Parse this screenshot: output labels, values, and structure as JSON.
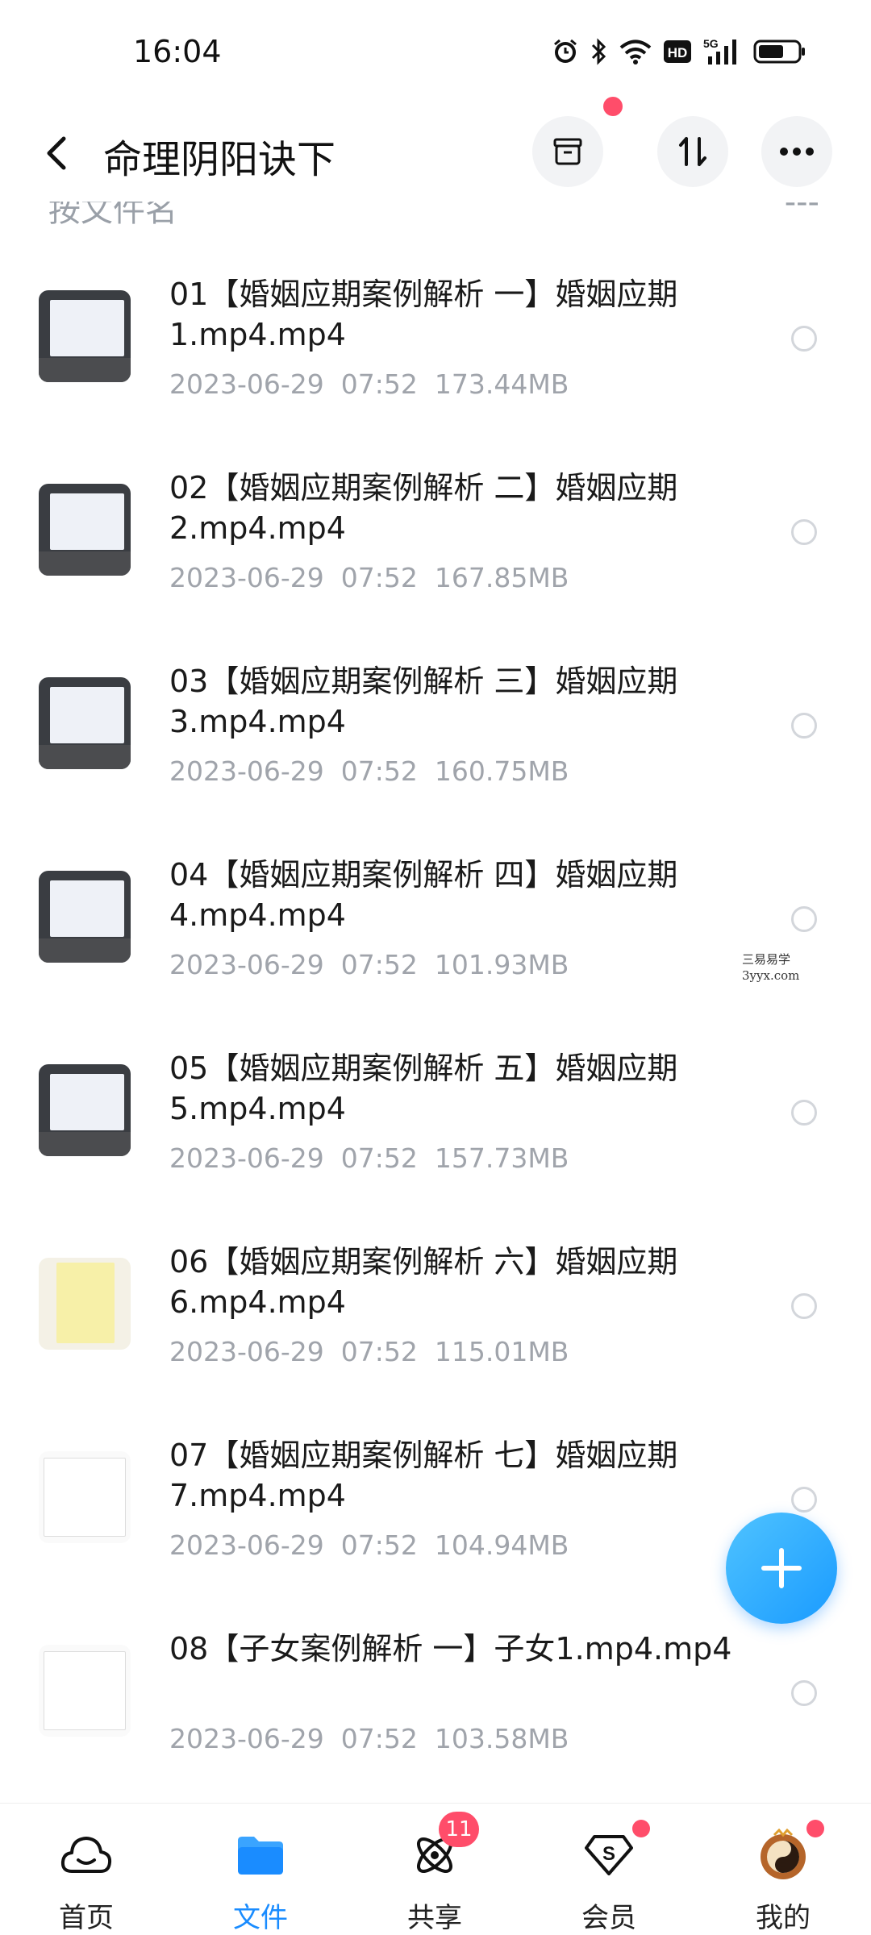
{
  "status_bar": {
    "time": "16:04",
    "icons": [
      "alarm-icon",
      "bluetooth-icon",
      "wifi-icon",
      "hd-icon",
      "signal-5g-icon",
      "battery-icon"
    ],
    "hd_label": "HD",
    "network_label": "5G"
  },
  "header": {
    "title": "命理阴阳诀下",
    "buttons": [
      "archive-icon",
      "sort-icon",
      "more-icon"
    ]
  },
  "partial_row": {
    "left_text": "按文件名",
    "right_text": "---"
  },
  "files": [
    {
      "name": "01【婚姻应期案例解析 一】婚姻应期1.mp4.mp4",
      "date": "2023-06-29",
      "time": "07:52",
      "size": "173.44MB",
      "thumb": "classroom"
    },
    {
      "name": "02【婚姻应期案例解析 二】婚姻应期2.mp4.mp4",
      "date": "2023-06-29",
      "time": "07:52",
      "size": "167.85MB",
      "thumb": "classroom"
    },
    {
      "name": "03【婚姻应期案例解析 三】婚姻应期3.mp4.mp4",
      "date": "2023-06-29",
      "time": "07:52",
      "size": "160.75MB",
      "thumb": "classroom"
    },
    {
      "name": "04【婚姻应期案例解析 四】婚姻应期4.mp4.mp4",
      "date": "2023-06-29",
      "time": "07:52",
      "size": "101.93MB",
      "thumb": "classroom"
    },
    {
      "name": "05【婚姻应期案例解析 五】婚姻应期5.mp4.mp4",
      "date": "2023-06-29",
      "time": "07:52",
      "size": "157.73MB",
      "thumb": "classroom"
    },
    {
      "name": "06【婚姻应期案例解析 六】婚姻应期6.mp4.mp4",
      "date": "2023-06-29",
      "time": "07:52",
      "size": "115.01MB",
      "thumb": "paper"
    },
    {
      "name": "07【婚姻应期案例解析 七】婚姻应期7.mp4.mp4",
      "date": "2023-06-29",
      "time": "07:52",
      "size": "104.94MB",
      "thumb": "doc"
    },
    {
      "name": "08【子女案例解析 一】子女1.mp4.mp4",
      "date": "2023-06-29",
      "time": "07:52",
      "size": "103.58MB",
      "thumb": "doc"
    }
  ],
  "watermark": {
    "line1": "三易易学",
    "line2": "3yyx.com"
  },
  "fab": {
    "icon": "plus-icon"
  },
  "bottom_nav": [
    {
      "label": "首页",
      "icon": "cloud-icon",
      "active": false
    },
    {
      "label": "文件",
      "icon": "folder-icon",
      "active": true
    },
    {
      "label": "共享",
      "icon": "share-orbit-icon",
      "active": false,
      "badge": "11"
    },
    {
      "label": "会员",
      "icon": "vip-diamond-icon",
      "active": false,
      "dot": true
    },
    {
      "label": "我的",
      "icon": "avatar-icon",
      "active": false,
      "dot": true
    }
  ],
  "colors": {
    "accent": "#1a8cff",
    "badge": "#ff4d6a",
    "meta_text": "#a0a4ab"
  }
}
